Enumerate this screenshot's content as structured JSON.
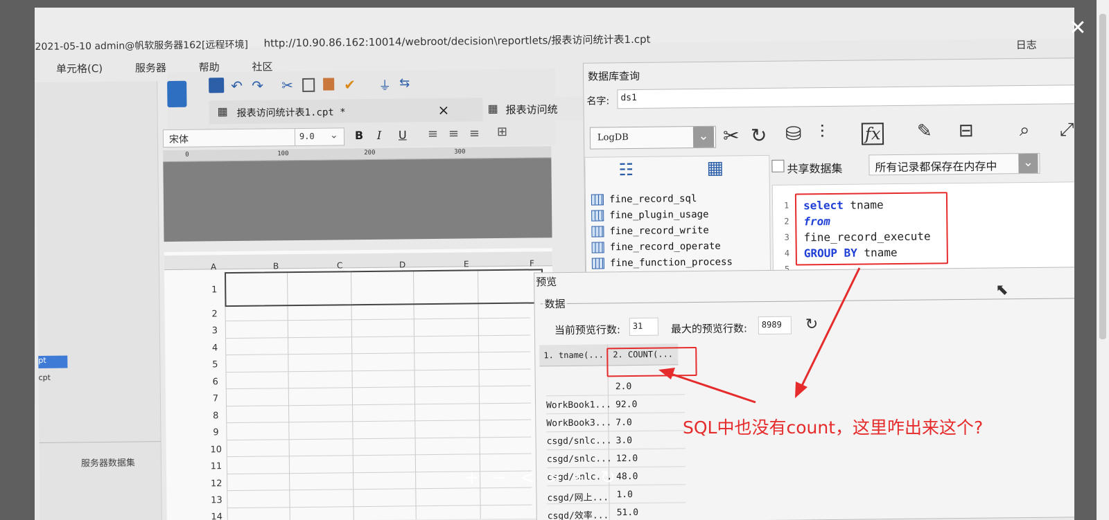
{
  "titlebar": {
    "text": "2021-05-10 admin@帆软服务器162[远程环境]",
    "url": "http://10.90.86.162:10014/webroot/decision\\reportlets/报表访问统计表1.cpt",
    "log_label": "日志"
  },
  "menu": [
    "单元格(C)",
    "服务器",
    "帮助",
    "社区"
  ],
  "left_panel": {
    "items": [
      "pt",
      "cpt"
    ],
    "server_dataset_label": "服务器数据集"
  },
  "editor_tabs": [
    {
      "label": "报表访问统计表1.cpt *",
      "close": "×"
    },
    {
      "label": "报表访问统"
    }
  ],
  "format_bar": {
    "font": "宋体",
    "size": "9.0",
    "bold": "B",
    "italic": "I",
    "underline": "U"
  },
  "ruler": {
    "ticks": [
      "0",
      "100",
      "200",
      "300"
    ]
  },
  "sheet": {
    "columns": [
      "A",
      "B",
      "C",
      "D",
      "E",
      "F"
    ],
    "rows": [
      "1",
      "2",
      "3",
      "4",
      "5",
      "6",
      "7",
      "8",
      "9",
      "10",
      "11",
      "12",
      "13",
      "14"
    ]
  },
  "db_query": {
    "title": "数据库查询",
    "name_label": "名字:",
    "name_value": "ds1",
    "connection": "LogDB",
    "shared_dataset_label": "共享数据集",
    "memory_option": "所有记录都保存在内存中",
    "tables": [
      "fine_record_sql",
      "fine_plugin_usage",
      "fine_record_write",
      "fine_record_operate",
      "fine_function_process"
    ],
    "sql_lines": [
      {
        "num": "1",
        "kw": "select",
        "rest": " tname"
      },
      {
        "num": "2",
        "kw": "from",
        "rest": ""
      },
      {
        "num": "3",
        "kw": "",
        "rest": "fine_record_execute"
      },
      {
        "num": "4",
        "kw": "GROUP BY",
        "rest": " tname"
      },
      {
        "num": "5",
        "kw": "",
        "rest": ""
      }
    ]
  },
  "preview": {
    "title": "预览",
    "group_label": "数据",
    "current_rows_label": "当前预览行数:",
    "current_rows_value": "31",
    "max_rows_label": "最大的预览行数:",
    "max_rows_value": "8989",
    "columns": [
      "1. tname(...",
      "2. COUNT(..."
    ],
    "rows": [
      [
        "",
        "2.0"
      ],
      [
        "WorkBook1...",
        "92.0"
      ],
      [
        "WorkBook3...",
        "7.0"
      ],
      [
        "csgd/snlc...",
        "3.0"
      ],
      [
        "csgd/snlc...",
        "12.0"
      ],
      [
        "csgd/snlc...",
        "48.0"
      ],
      [
        "csgd/网上...",
        "1.0"
      ],
      [
        "csgd/效率...",
        "51.0"
      ]
    ]
  },
  "annotation": {
    "text": "SQL中也没有count，这里咋出来这个?",
    "color": "#e52b2b"
  },
  "viewer_controls": [
    "+",
    "−",
    "<",
    ">",
    "⌖",
    "↻"
  ]
}
